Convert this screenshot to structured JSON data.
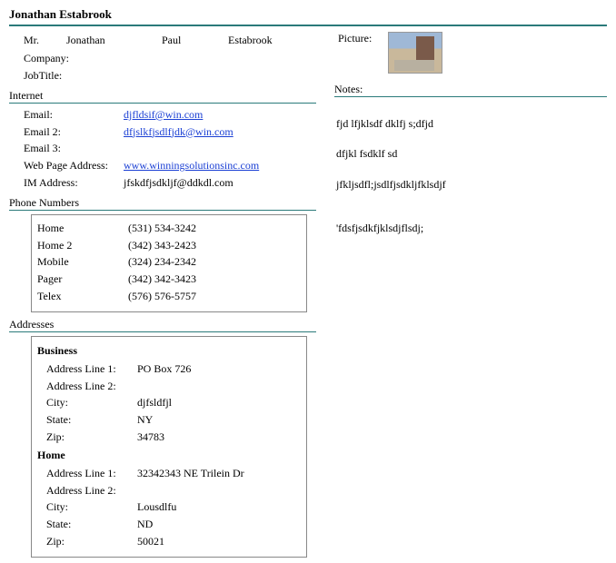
{
  "title": "Jonathan Estabrook",
  "name": {
    "prefix": "Mr.",
    "first": "Jonathan",
    "middle": "Paul",
    "last": "Estabrook"
  },
  "labels": {
    "company": "Company:",
    "jobtitle": "JobTitle:",
    "internet": "Internet",
    "email": "Email:",
    "email2": "Email 2:",
    "email3": "Email 3:",
    "webpage": "Web Page Address:",
    "im": "IM Address:",
    "phone": "Phone Numbers",
    "addresses": "Addresses",
    "business": "Business",
    "home": "Home",
    "addr1": "Address Line 1:",
    "addr2": "Address Line 2:",
    "city": "City:",
    "state": "State:",
    "zip": "Zip:",
    "picture": "Picture:",
    "notes": "Notes:"
  },
  "company": "",
  "jobtitle": "",
  "internet": {
    "email": "djfldsif@win.com",
    "email2": "dfjslkfjsdlfjdk@win.com",
    "email3": "",
    "webpage": "www.winningsolutionsinc.com",
    "im": "jfskdfjsdkljf@ddkdl.com"
  },
  "phones": [
    {
      "label": "Home",
      "value": "(531) 534-3242"
    },
    {
      "label": "Home 2",
      "value": "(342) 343-2423"
    },
    {
      "label": "Mobile",
      "value": "(324) 234-2342"
    },
    {
      "label": "Pager",
      "value": "(342) 342-3423"
    },
    {
      "label": "Telex",
      "value": "(576) 576-5757"
    }
  ],
  "addresses": {
    "business": {
      "line1": "PO Box 726",
      "line2": "",
      "city": "djfsldfjl",
      "state": "NY",
      "zip": "34783"
    },
    "home": {
      "line1": "32342343 NE Trilein Dr",
      "line2": "",
      "city": "Lousdlfu",
      "state": "ND",
      "zip": "50021"
    }
  },
  "notes": {
    "line1": "fjd lfjklsdf dklfj s;dfjd",
    "line2": "dfjkl fsdklf sd",
    "line3": "jfkljsdfl;jsdlfjsdkljfklsdjf",
    "line4": "'fdsfjsdkfjklsdjflsdj;"
  }
}
